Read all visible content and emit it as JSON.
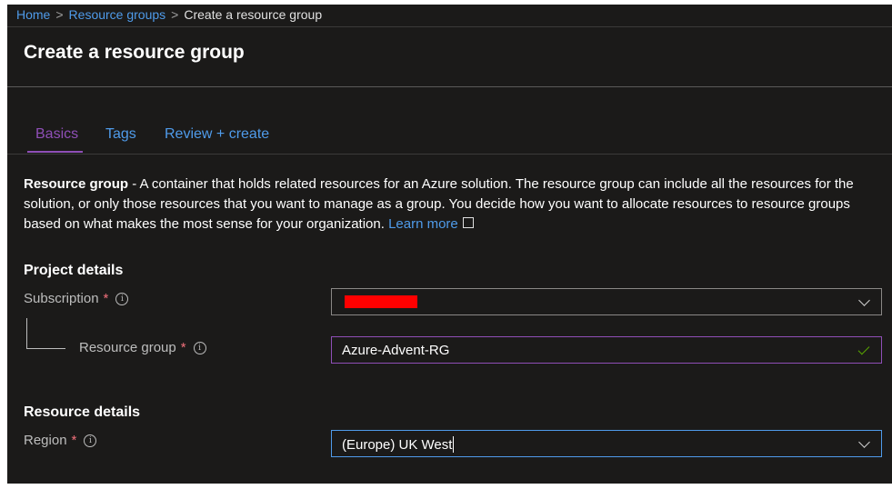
{
  "breadcrumb": {
    "home": "Home",
    "resource_groups": "Resource groups",
    "current": "Create a resource group",
    "separator": ">"
  },
  "page": {
    "title": "Create a resource group"
  },
  "tabs": [
    {
      "label": "Basics",
      "active": true
    },
    {
      "label": "Tags",
      "active": false
    },
    {
      "label": "Review + create",
      "active": false
    }
  ],
  "description": {
    "bold": "Resource group",
    "text": " - A container that holds related resources for an Azure solution. The resource group can include all the resources for the solution, or only those resources that you want to manage as a group. You decide how you want to allocate resources to resource groups based on what makes the most sense for your organization. ",
    "learn_more": "Learn more"
  },
  "project_details": {
    "title": "Project details",
    "subscription": {
      "label": "Subscription",
      "required": "*",
      "value_redacted": true
    },
    "resource_group": {
      "label": "Resource group",
      "required": "*",
      "value": "Azure-Advent-RG",
      "valid": true
    }
  },
  "resource_details": {
    "title": "Resource details",
    "region": {
      "label": "Region",
      "required": "*",
      "value": "(Europe) UK West"
    }
  },
  "icons": {
    "info": "info-icon",
    "chevron": "chevron-down-icon",
    "check": "checkmark-icon",
    "external": "external-link-icon"
  },
  "colors": {
    "background": "#1b1a19",
    "link": "#4f9bea",
    "accent": "#8f4fb7",
    "required": "#f1707b",
    "valid": "#57a300",
    "redaction": "#ff0000"
  }
}
